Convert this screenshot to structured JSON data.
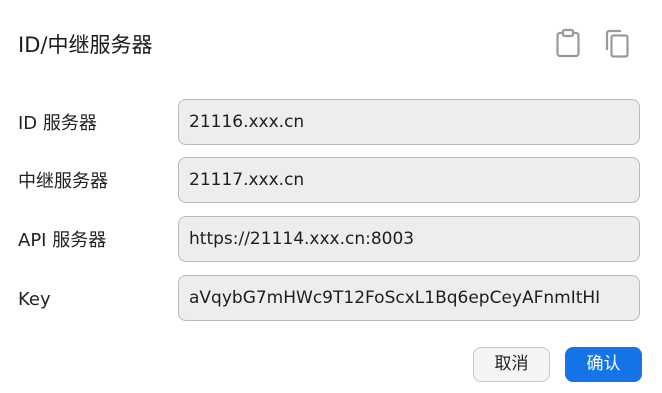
{
  "dialog": {
    "title": "ID/中继服务器"
  },
  "header_icons": {
    "paste": "clipboard-icon",
    "copy": "copy-icon"
  },
  "fields": {
    "id_server": {
      "label": "ID 服务器",
      "value": "21116.xxx.cn"
    },
    "relay_server": {
      "label": "中继服务器",
      "value": "21117.xxx.cn"
    },
    "api_server": {
      "label": "API 服务器",
      "value": "https://21114.xxx.cn:8003"
    },
    "key": {
      "label": "Key",
      "value": "aVqybG7mHWc9T12FoScxL1Bq6epCeyAFnmItHI"
    }
  },
  "buttons": {
    "cancel": "取消",
    "ok": "确认"
  },
  "colors": {
    "accent": "#1575e8",
    "field_bg": "#ededed",
    "field_border": "#b9b9b9"
  }
}
